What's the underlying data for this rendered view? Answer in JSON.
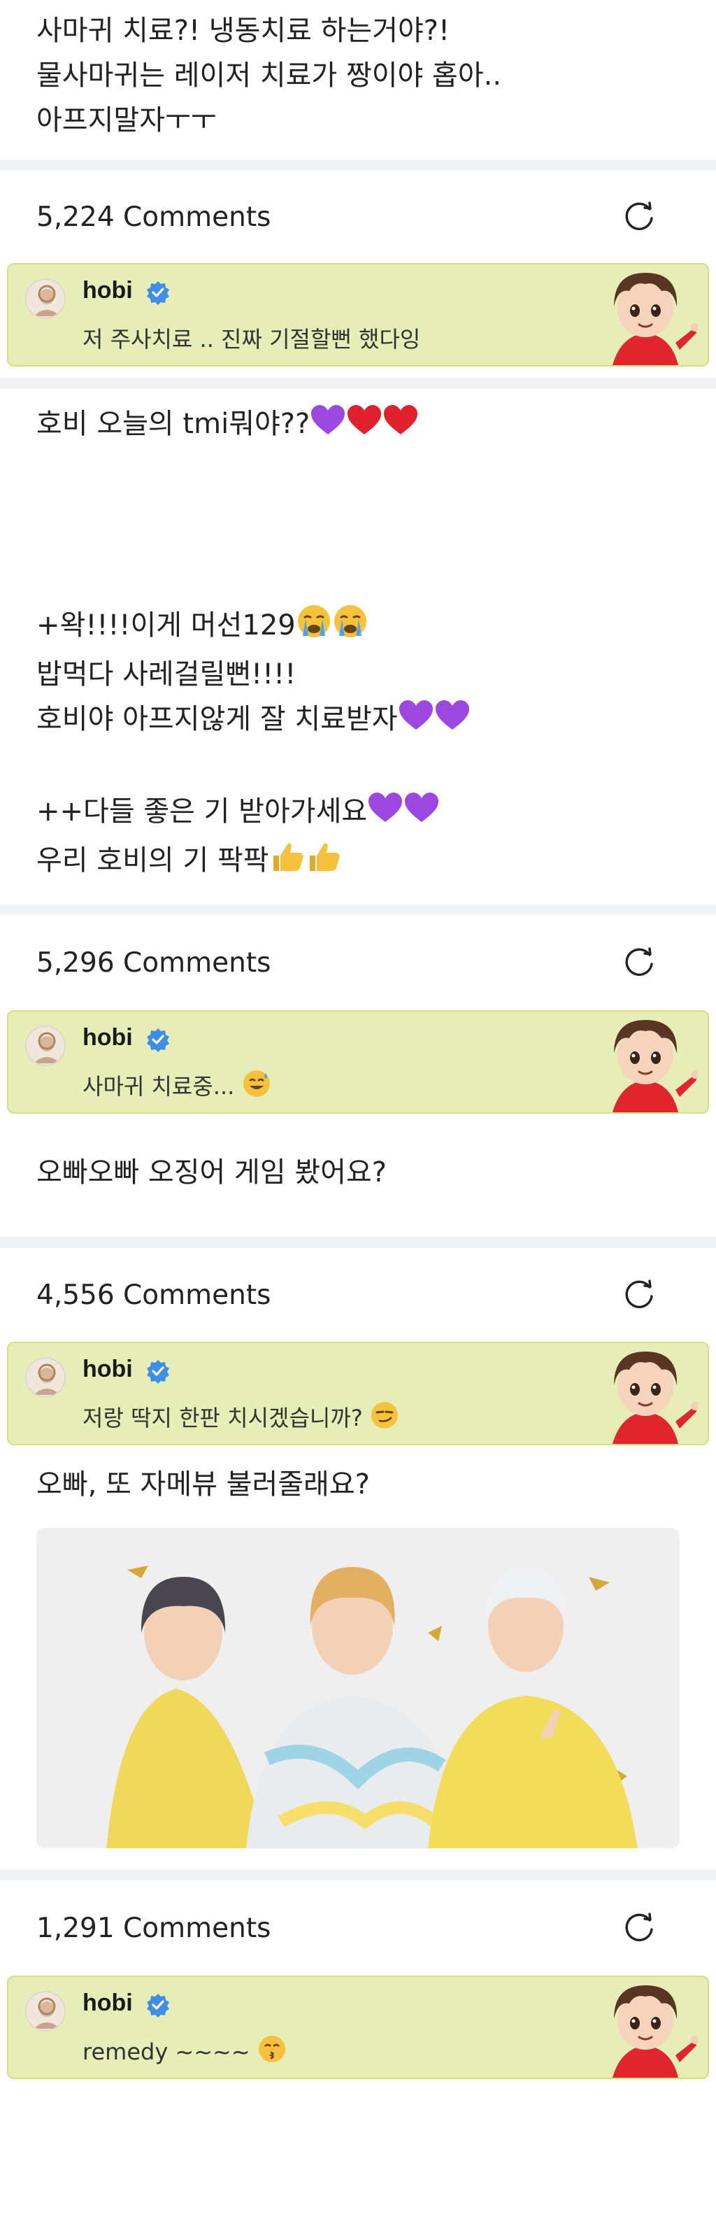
{
  "post1": {
    "lines": [
      "사마귀 치료?! 냉동치료 하는거야?!",
      "물사마귀는 레이저 치료가 짱이야 홉아..",
      "아프지말자ㅜㅜ"
    ]
  },
  "thread1": {
    "comments_count": "5,224 Comments",
    "reply": {
      "name": "hobi",
      "text": "저 주사치료 .. 진짜 기절할뻔 했다잉"
    }
  },
  "post2": {
    "line1": "호비 오늘의 tmi뭐야??",
    "line2": "+왁!!!!이게 머선129",
    "line3": "밥먹다 사레걸릴뻔!!!!",
    "line4": "호비야 아프지않게 잘 치료받자",
    "line5": "++다들 좋은 기 받아가세요",
    "line6": "우리 호비의 기 팍팍"
  },
  "thread2": {
    "comments_count": "5,296 Comments",
    "reply": {
      "name": "hobi",
      "text": "사마귀 치료중..."
    }
  },
  "post3": {
    "text": "오빠오빠 오징어 게임 봤어요?"
  },
  "thread3": {
    "comments_count": "4,556 Comments",
    "reply": {
      "name": "hobi",
      "text": "저랑 딱지 한판 치시겠습니까?"
    }
  },
  "post4": {
    "text": "오빠, 또 자메뷰 불러줄래요?"
  },
  "thread4": {
    "comments_count": "1,291 Comments",
    "reply": {
      "name": "hobi",
      "text": "remedy ~~~~"
    }
  },
  "colors": {
    "reply_bg": "#e6edb6",
    "reply_border": "#d6e081",
    "verified": "#3d8fe6",
    "heart_purple": "#9b47e0",
    "heart_red": "#e0202d"
  },
  "icons": [
    "refresh-icon",
    "verified-icon",
    "avatar",
    "sticker",
    "purple-heart-icon",
    "red-heart-icon",
    "crying-face-icon",
    "thumbs-up-icon",
    "sweat-smile-icon",
    "smirk-icon",
    "kissing-face-icon"
  ]
}
